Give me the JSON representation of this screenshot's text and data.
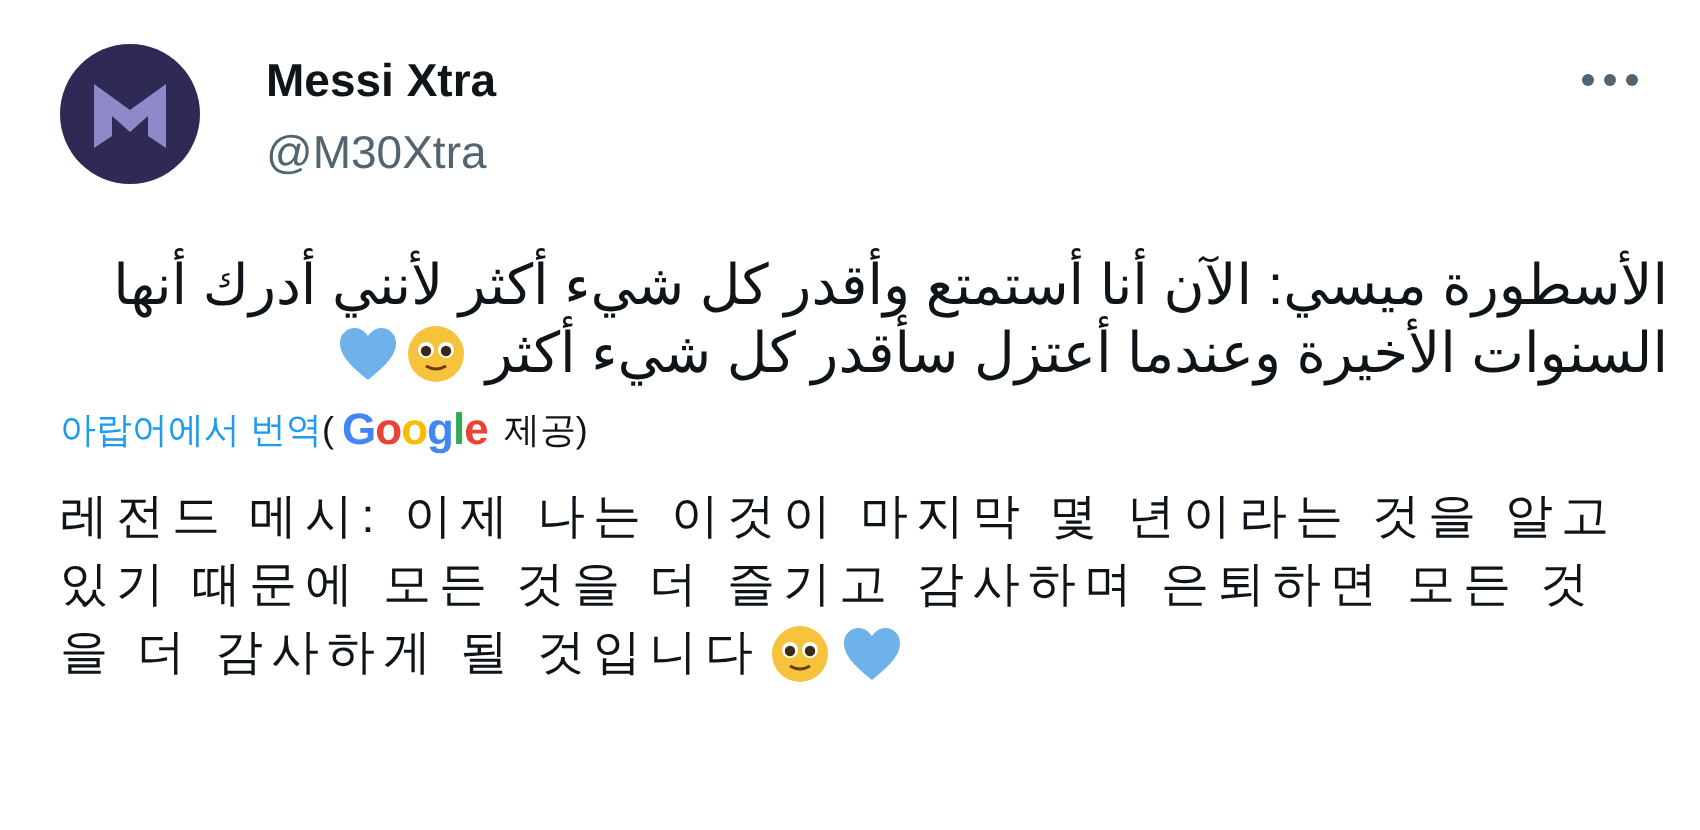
{
  "author": {
    "name": "Messi Xtra",
    "handle": "@M30Xtra"
  },
  "tweet": {
    "lines": [
      "الأسطورة ميسي: الآن أنا أستمتع وأقدر كل شيء أكثر لأنني أدرك أنها",
      "السنوات الأخيرة وعندما أعتزل سأقدر كل شيء أكثر"
    ]
  },
  "translation": {
    "link": "아랍어에서 번역",
    "open_paren": "(",
    "provider": "Google",
    "provider_suffix": "제공)",
    "lines": [
      "레전드 메시: 이제 나는 이것이 마지막 몇 년이라는 것을 알고",
      "있기 때문에 모든 것을 더 즐기고 감사하며 은퇴하면 모든 것",
      "을 더 감사하게 될 것입니다"
    ]
  }
}
